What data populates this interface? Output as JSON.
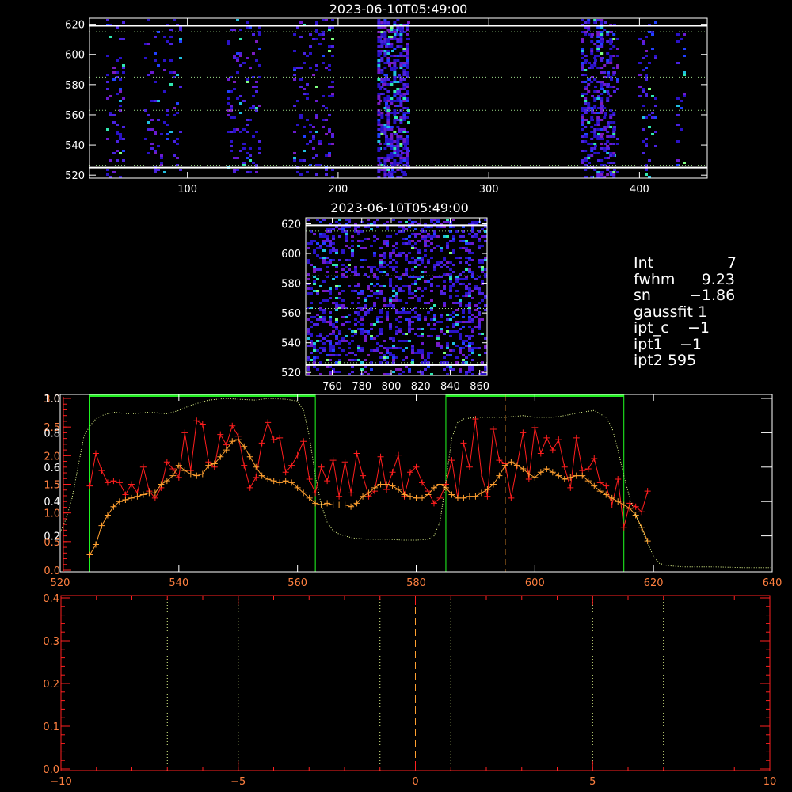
{
  "colors": {
    "background": "#000000",
    "frame": "#ffffff",
    "image_noise": [
      "#2a12c8",
      "#4a22e0",
      "#6a1ad0",
      "#7a1cc0",
      "#2040ff",
      "#20c0e0",
      "#30e8b0",
      "#80ff80"
    ],
    "roi_lines": "#ffffff",
    "boundary_green": "#22ff22",
    "bar_green": "#22ee22",
    "profile_red": "#ff1e1e",
    "profile_orange": "#ffa030",
    "dotted_light": "#e8ff90",
    "axis_orange": "#ff8040",
    "axis_red": "#ff2020"
  },
  "panel_top": {
    "title": "2023-06-10T05:49:00",
    "x_ticks": [
      "100",
      "200",
      "300",
      "400"
    ],
    "y_ticks": [
      "520",
      "540",
      "560",
      "580",
      "600",
      "620"
    ]
  },
  "panel_zoom": {
    "title": "2023-06-10T05:49:00",
    "x_ticks": [
      "760",
      "780",
      "800",
      "820",
      "840",
      "860"
    ],
    "y_ticks": [
      "520",
      "540",
      "560",
      "580",
      "600",
      "620"
    ]
  },
  "info": {
    "rows": [
      {
        "label": "Int",
        "value": "7"
      },
      {
        "label": "fwhm",
        "value": "9.23"
      },
      {
        "label": "sn",
        "value": "−1.86"
      },
      {
        "label": "gaussfit",
        "value": "1"
      },
      {
        "label": "ipt_c",
        "value": "−1"
      },
      {
        "label": "ipt1",
        "value": "−1"
      },
      {
        "label": "ipt2",
        "value": "595"
      }
    ]
  },
  "chart_data": [
    {
      "type": "image",
      "title": "2023-06-10T05:49:00",
      "xlim": [
        35,
        445
      ],
      "ylim": [
        518,
        624
      ],
      "x_ticks": [
        100,
        200,
        300,
        400
      ],
      "y_ticks": [
        520,
        540,
        560,
        580,
        600,
        620
      ],
      "bright_columns": [
        [
          45,
          58
        ],
        [
          70,
          95
        ],
        [
          125,
          148
        ],
        [
          170,
          196
        ],
        [
          225,
          246
        ],
        [
          360,
          385
        ],
        [
          398,
          410
        ],
        [
          423,
          430
        ]
      ],
      "roi_lines": [
        525,
        619
      ]
    },
    {
      "type": "image",
      "title": "2023-06-10T05:49:00",
      "xlim": [
        742,
        865
      ],
      "ylim": [
        518,
        624
      ],
      "x_ticks": [
        760,
        780,
        800,
        820,
        840,
        860
      ],
      "y_ticks": [
        520,
        540,
        560,
        580,
        600,
        620
      ],
      "roi_lines": [
        525,
        619
      ]
    },
    {
      "type": "line",
      "xlim": [
        520,
        640
      ],
      "x_ticks": [
        520,
        540,
        560,
        580,
        600,
        620,
        640
      ],
      "left_axis_1": {
        "ticks": [
          "0.0",
          "0.5",
          "1.0",
          "1.5",
          "2.0",
          "2.5",
          "3.0"
        ],
        "lim": [
          0,
          3.0
        ]
      },
      "left_axis_2": {
        "ticks": [
          "0.2",
          "0.4",
          "0.6",
          "0.8",
          "1.0"
        ],
        "lim": [
          0,
          1.0
        ]
      },
      "boundaries": [
        525,
        563,
        585,
        615
      ],
      "bars": [
        [
          525,
          563
        ],
        [
          585,
          615
        ]
      ],
      "marker_x": 595,
      "series": [
        {
          "color": "profile_red",
          "x": [
            525,
            526,
            527,
            528,
            529,
            530,
            531,
            532,
            533,
            534,
            535,
            536,
            537,
            538,
            539,
            540,
            541,
            542,
            543,
            544,
            545,
            546,
            547,
            548,
            549,
            550,
            551,
            552,
            553,
            554,
            555,
            556,
            557,
            558,
            559,
            560,
            561,
            562,
            563,
            564,
            565,
            566,
            567,
            568,
            569,
            570,
            571,
            572,
            573,
            574,
            575,
            576,
            577,
            578,
            579,
            580,
            581,
            582,
            583,
            584,
            585,
            586,
            587,
            588,
            589,
            590,
            591,
            592,
            593,
            594,
            595,
            596,
            597,
            598,
            599,
            600,
            601,
            602,
            603,
            604,
            605,
            606,
            607,
            608,
            609,
            610,
            611,
            612,
            613,
            614,
            615,
            616,
            617,
            618,
            619
          ],
          "y": [
            0.49,
            0.68,
            0.58,
            0.51,
            0.52,
            0.51,
            0.44,
            0.5,
            0.45,
            0.6,
            0.46,
            0.42,
            0.48,
            0.63,
            0.59,
            0.54,
            0.8,
            0.58,
            0.87,
            0.85,
            0.63,
            0.6,
            0.79,
            0.73,
            0.84,
            0.78,
            0.61,
            0.48,
            0.54,
            0.74,
            0.86,
            0.76,
            0.77,
            0.57,
            0.61,
            0.67,
            0.75,
            0.53,
            0.45,
            0.6,
            0.52,
            0.64,
            0.43,
            0.63,
            0.45,
            0.68,
            0.55,
            0.43,
            0.46,
            0.66,
            0.47,
            0.57,
            0.67,
            0.43,
            0.57,
            0.6,
            0.51,
            0.46,
            0.39,
            0.42,
            0.5,
            0.64,
            0.42,
            0.74,
            0.6,
            0.88,
            0.56,
            0.43,
            0.82,
            0.64,
            0.62,
            0.42,
            0.61,
            0.8,
            0.53,
            0.83,
            0.68,
            0.77,
            0.7,
            0.76,
            0.6,
            0.48,
            0.77,
            0.58,
            0.59,
            0.65,
            0.51,
            0.49,
            0.38,
            0.53,
            0.25,
            0.39,
            0.37,
            0.34,
            0.46
          ]
        },
        {
          "color": "profile_orange",
          "x": [
            525,
            526,
            527,
            528,
            529,
            530,
            531,
            532,
            533,
            534,
            535,
            536,
            537,
            538,
            539,
            540,
            541,
            542,
            543,
            544,
            545,
            546,
            547,
            548,
            549,
            550,
            551,
            552,
            553,
            554,
            555,
            556,
            557,
            558,
            559,
            560,
            561,
            562,
            563,
            564,
            565,
            566,
            567,
            568,
            569,
            570,
            571,
            572,
            573,
            574,
            575,
            576,
            577,
            578,
            579,
            580,
            581,
            582,
            583,
            584,
            585,
            586,
            587,
            588,
            589,
            590,
            591,
            592,
            593,
            594,
            595,
            596,
            597,
            598,
            599,
            600,
            601,
            602,
            603,
            604,
            605,
            606,
            607,
            608,
            609,
            610,
            611,
            612,
            613,
            614,
            615,
            616,
            617,
            618,
            619
          ],
          "y": [
            0.09,
            0.15,
            0.26,
            0.32,
            0.37,
            0.4,
            0.41,
            0.42,
            0.43,
            0.44,
            0.45,
            0.45,
            0.5,
            0.52,
            0.55,
            0.61,
            0.58,
            0.56,
            0.55,
            0.56,
            0.61,
            0.62,
            0.66,
            0.7,
            0.75,
            0.76,
            0.72,
            0.66,
            0.6,
            0.55,
            0.53,
            0.52,
            0.51,
            0.52,
            0.51,
            0.48,
            0.45,
            0.42,
            0.39,
            0.38,
            0.39,
            0.38,
            0.38,
            0.38,
            0.37,
            0.39,
            0.43,
            0.45,
            0.48,
            0.5,
            0.5,
            0.49,
            0.47,
            0.44,
            0.43,
            0.42,
            0.42,
            0.44,
            0.48,
            0.5,
            0.48,
            0.44,
            0.42,
            0.42,
            0.43,
            0.43,
            0.45,
            0.47,
            0.5,
            0.55,
            0.61,
            0.63,
            0.61,
            0.59,
            0.56,
            0.54,
            0.57,
            0.59,
            0.57,
            0.55,
            0.53,
            0.54,
            0.55,
            0.55,
            0.52,
            0.49,
            0.46,
            0.44,
            0.42,
            0.4,
            0.38,
            0.36,
            0.32,
            0.25,
            0.17
          ]
        },
        {
          "color": "dotted_light",
          "x": [
            520,
            521,
            522,
            523,
            524,
            525,
            526,
            527,
            528,
            529,
            530,
            532,
            535,
            538,
            540,
            542,
            545,
            548,
            550,
            553,
            555,
            558,
            560,
            561,
            562,
            563,
            564,
            565,
            566,
            567,
            568,
            569,
            570,
            572,
            575,
            578,
            580,
            582,
            583,
            584,
            585,
            586,
            587,
            588,
            590,
            593,
            595,
            598,
            600,
            603,
            605,
            608,
            610,
            612,
            613,
            614,
            615,
            616,
            617,
            618,
            619,
            620,
            621,
            622,
            623,
            625,
            630,
            635,
            640
          ],
          "y": [
            0.22,
            0.3,
            0.42,
            0.6,
            0.78,
            0.84,
            0.88,
            0.9,
            0.91,
            0.92,
            0.915,
            0.91,
            0.92,
            0.91,
            0.93,
            0.96,
            0.99,
            1.0,
            0.995,
            0.99,
            1.0,
            0.995,
            0.985,
            0.93,
            0.78,
            0.55,
            0.38,
            0.28,
            0.23,
            0.21,
            0.2,
            0.19,
            0.185,
            0.18,
            0.18,
            0.175,
            0.175,
            0.18,
            0.2,
            0.28,
            0.52,
            0.77,
            0.86,
            0.88,
            0.89,
            0.89,
            0.89,
            0.9,
            0.89,
            0.89,
            0.9,
            0.92,
            0.93,
            0.89,
            0.83,
            0.7,
            0.55,
            0.42,
            0.32,
            0.24,
            0.16,
            0.08,
            0.04,
            0.03,
            0.025,
            0.02,
            0.02,
            0.015,
            0.015
          ]
        }
      ]
    },
    {
      "type": "line",
      "xlim": [
        -10,
        10
      ],
      "ylim": [
        0,
        0.4
      ],
      "x_ticks": [
        "−10",
        "−5",
        "0",
        "5",
        "10"
      ],
      "x_tick_values": [
        -10,
        -5,
        0,
        5,
        10
      ],
      "y_ticks": [
        "0.0",
        "0.1",
        "0.2",
        "0.3",
        "0.4"
      ],
      "y_tick_values": [
        0,
        0.1,
        0.2,
        0.3,
        0.4
      ],
      "dotted_verticals": [
        -7,
        -5,
        -1,
        1,
        5,
        7
      ],
      "dashed_vertical": 0,
      "series": []
    }
  ]
}
